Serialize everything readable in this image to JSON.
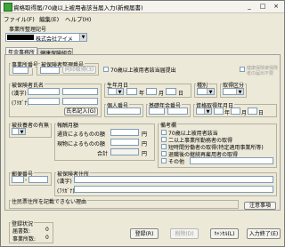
{
  "window": {
    "title": "資格取得届/70歳以上被用者該当届入力(新規届書)",
    "minimize": "_",
    "maximize": "□",
    "close": "×"
  },
  "menu": [
    "ファイル(F)",
    "編集(E)",
    "ヘルプ(H)"
  ],
  "office": {
    "group_label": "事業所整理記号",
    "name_value": "株式会社アイメ"
  },
  "tabs": [
    "年金事務所",
    "健康保険組合"
  ],
  "form": {
    "insured_no_label": "事業所番号",
    "seiri_label": "被保険者整理番号",
    "seiri_button": "同印取得(3)",
    "over70_label": "70歳以上被用者該当届提出",
    "kenpo_label": "健康保険被保険者の届出不要",
    "name_label": "被保険者氏名",
    "furigana_label": "(ﾌﾘｶﾞﾅ)",
    "kanji_label": "(漢字)",
    "shi_label": "(氏)",
    "mei_label": "(名)",
    "name_btn": "氏名記入(G)",
    "birth_label": "生年月日",
    "nen": "年",
    "tsuki": "月",
    "hi": "日",
    "sex_label": "種別",
    "kubun_label": "取得区分",
    "mynum_label": "個人番号",
    "kiso_label": "基礎年金番号",
    "shikaku_label": "資格取得年月日",
    "fuyou_label": "被扶養者の有無",
    "pay_label": "報酬月額",
    "pay_currency": "通貨によるものの額",
    "pay_goods": "現物によるものの額",
    "pay_total": "合計",
    "en": "円",
    "bikou_label": "備考欄",
    "bikou_items": [
      "70歳以上被用者該当",
      "二以上事業所勤務者の取得",
      "短時間労働者の取得(特定適用事業所等)",
      "退職後の継続再雇用者の取得",
      "その他"
    ],
    "zip_label": "郵便番号",
    "address_label": "被保険者住所",
    "address_kanji": "(漢字)",
    "address_kana": "(ﾌﾘｶﾞﾅ)",
    "reason_label": "住民票住所を記載できない理由",
    "notes_btn": "注意事項"
  },
  "register": {
    "label": "登録状況",
    "count_label": "届書数:",
    "count_value": "0",
    "people_label": "事業所数:",
    "people_value": "0"
  },
  "buttons": {
    "register": "登録(R)",
    "delete": "削除(D)",
    "cancel": "ｷｬﾝｾﾙ(L)",
    "finish": "入力終了(E)"
  }
}
